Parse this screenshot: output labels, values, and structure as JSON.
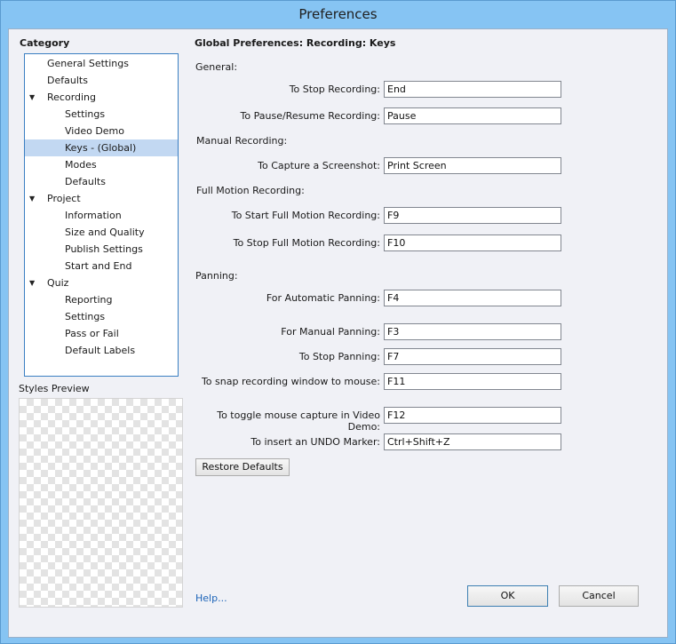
{
  "window": {
    "title": "Preferences"
  },
  "sidebar": {
    "category_label": "Category",
    "items": [
      {
        "label": "General Settings",
        "level": 0,
        "expandable": false,
        "selected": false
      },
      {
        "label": "Defaults",
        "level": 0,
        "expandable": false,
        "selected": false
      },
      {
        "label": "Recording",
        "level": 0,
        "expandable": true,
        "selected": false
      },
      {
        "label": "Settings",
        "level": 1,
        "expandable": false,
        "selected": false
      },
      {
        "label": "Video Demo",
        "level": 1,
        "expandable": false,
        "selected": false
      },
      {
        "label": "Keys - (Global)",
        "level": 1,
        "expandable": false,
        "selected": true
      },
      {
        "label": "Modes",
        "level": 1,
        "expandable": false,
        "selected": false
      },
      {
        "label": "Defaults",
        "level": 1,
        "expandable": false,
        "selected": false
      },
      {
        "label": "Project",
        "level": 0,
        "expandable": true,
        "selected": false
      },
      {
        "label": "Information",
        "level": 1,
        "expandable": false,
        "selected": false
      },
      {
        "label": "Size and Quality",
        "level": 1,
        "expandable": false,
        "selected": false
      },
      {
        "label": "Publish Settings",
        "level": 1,
        "expandable": false,
        "selected": false
      },
      {
        "label": "Start and End",
        "level": 1,
        "expandable": false,
        "selected": false
      },
      {
        "label": "Quiz",
        "level": 0,
        "expandable": true,
        "selected": false
      },
      {
        "label": "Reporting",
        "level": 1,
        "expandable": false,
        "selected": false
      },
      {
        "label": "Settings",
        "level": 1,
        "expandable": false,
        "selected": false
      },
      {
        "label": "Pass or Fail",
        "level": 1,
        "expandable": false,
        "selected": false
      },
      {
        "label": "Default Labels",
        "level": 1,
        "expandable": false,
        "selected": false
      }
    ],
    "styles_preview_label": "Styles Preview",
    "help_label": "Help..."
  },
  "panel": {
    "title": "Global Preferences: Recording: Keys",
    "sections": {
      "general": "General:",
      "manual": "Manual Recording:",
      "full_motion": "Full Motion Recording:",
      "panning": "Panning:"
    },
    "rows": [
      {
        "label": "To Stop Recording:",
        "value": "End"
      },
      {
        "label": "To Pause/Resume Recording:",
        "value": "Pause"
      },
      {
        "label": "To Capture a Screenshot:",
        "value": "Print Screen"
      },
      {
        "label": "To Start Full Motion Recording:",
        "value": "F9"
      },
      {
        "label": "To Stop Full Motion Recording:",
        "value": "F10"
      },
      {
        "label": "For Automatic Panning:",
        "value": "F4"
      },
      {
        "label": "For Manual Panning:",
        "value": "F3"
      },
      {
        "label": "To Stop Panning:",
        "value": "F7"
      },
      {
        "label": "To snap recording window to mouse:",
        "value": "F11"
      },
      {
        "label": "To toggle mouse capture in Video Demo:",
        "value": "F12"
      },
      {
        "label": "To insert an UNDO Marker:",
        "value": "Ctrl+Shift+Z"
      }
    ],
    "restore_label": "Restore Defaults"
  },
  "buttons": {
    "ok": "OK",
    "cancel": "Cancel"
  },
  "colors": {
    "titlebar": "#86c4f3",
    "selection": "#c2d8f2",
    "link": "#1d64b8",
    "tree_border": "#3b7fc2"
  }
}
